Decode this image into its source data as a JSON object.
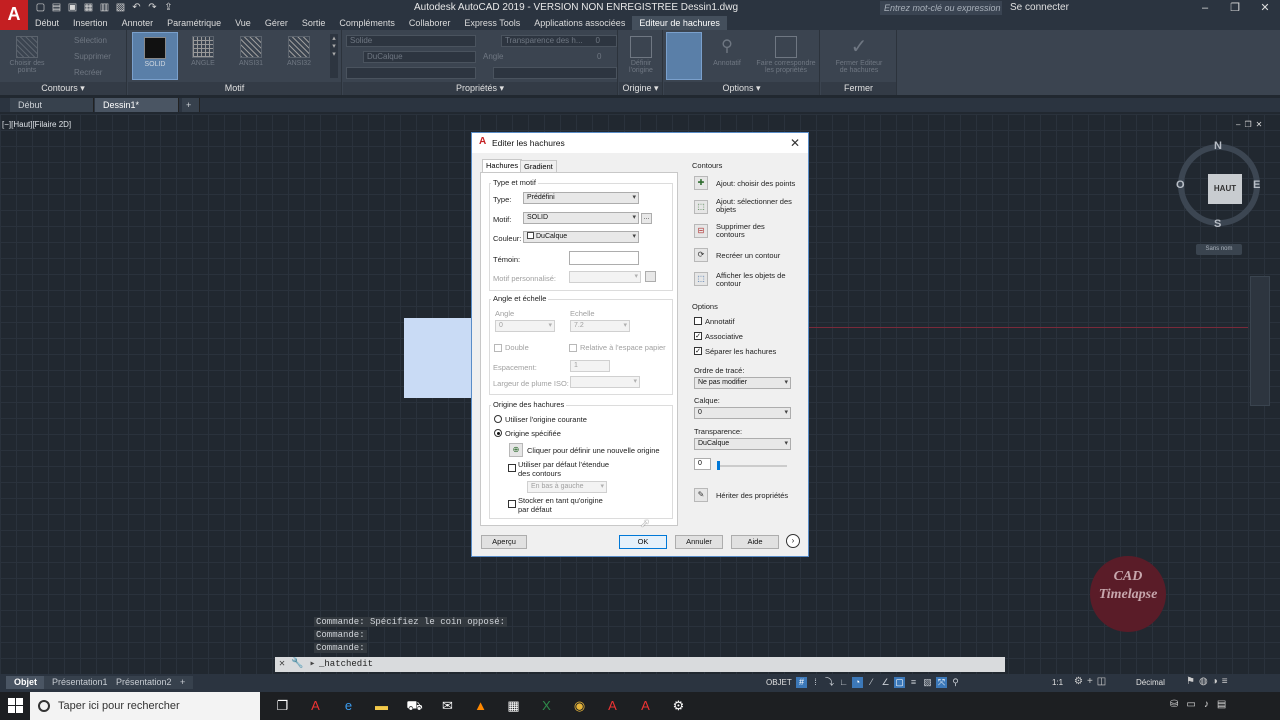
{
  "titlebar": {
    "logo": "A",
    "title": "Autodesk AutoCAD 2019 - VERSION NON ENREGISTREE    Dessin1.dwg",
    "search_placeholder": "Entrez mot-clé ou expression",
    "connect": "Se connecter",
    "qat_icons": [
      "new-icon",
      "open-icon",
      "save-icon",
      "saveas-icon",
      "print-icon",
      "plot-icon",
      "undo-icon",
      "redo-icon",
      "share-icon"
    ]
  },
  "menu": [
    "Début",
    "Insertion",
    "Annoter",
    "Paramétrique",
    "Vue",
    "Gérer",
    "Sortie",
    "Compléments",
    "Collaborer",
    "Express Tools",
    "Applications associées",
    "Editeur de hachures"
  ],
  "ribbon": {
    "contours": {
      "title": "Contours",
      "pick": "Choisir des points",
      "select": "Sélection",
      "remove": "Supprimer",
      "recreate": "Recréer"
    },
    "motif": {
      "title": "Motif",
      "patterns": [
        "SOLID",
        "ANGLE",
        "ANSI31",
        "ANSI32"
      ]
    },
    "proprietes": {
      "title": "Propriétés",
      "type": "Solide",
      "color": "DuCalque",
      "transparency": "Transparence des h...",
      "transparency_val": "0",
      "angle": "Angle",
      "angle_val": "0"
    },
    "origine": {
      "title": "Origine",
      "btn": "Définir l'origine"
    },
    "options": {
      "title": "Options",
      "assoc": "Associative",
      "annot": "Annotatif",
      "match": "Faire correspondre les propriétés"
    },
    "fermer": {
      "title": "Fermer",
      "btn": "Fermer Editeur de hachures"
    }
  },
  "doctabs": [
    "Début",
    "Dessin1*",
    "+"
  ],
  "viewport_label": "[−][Haut][Filaire 2D]",
  "viewcube": {
    "face": "HAUT",
    "n": "N",
    "s": "S",
    "e": "E",
    "o": "O",
    "ucs": "Sans nom"
  },
  "watermark": "CAD Timelapse",
  "command_history": [
    "Commande: Spécifiez le coin opposé:",
    "Commande:",
    "Commande:"
  ],
  "command_input": "_hatchedit",
  "layout_tabs": [
    "Objet",
    "Présentation1",
    "Présentation2",
    "+"
  ],
  "status": {
    "model": "OBJET",
    "units": "Décimal",
    "scale": "1:1"
  },
  "taskbar": {
    "search": "Taper ici pour rechercher"
  },
  "dialog": {
    "title": "Editer les hachures",
    "tabs": [
      "Hachures",
      "Gradient"
    ],
    "type_motif": {
      "group": "Type et motif",
      "type_label": "Type:",
      "type_value": "Prédéfini",
      "motif_label": "Motif:",
      "motif_value": "SOLID",
      "couleur_label": "Couleur:",
      "couleur_value": "DuCalque",
      "temoin_label": "Témoin:",
      "perso_label": "Motif personnalisé:"
    },
    "angle_echelle": {
      "group": "Angle et échelle",
      "angle_label": "Angle",
      "angle_value": "0",
      "echelle_label": "Echelle",
      "echelle_value": "7.2",
      "double": "Double",
      "relative": "Relative à l'espace papier",
      "espacement_label": "Espacement:",
      "espacement_value": "1",
      "plume_label": "Largeur de plume ISO:"
    },
    "origine": {
      "group": "Origine des hachures",
      "courante": "Utiliser l'origine courante",
      "specifiee": "Origine spécifiée",
      "cliquer": "Cliquer pour définir une nouvelle origine",
      "defaut_etendue": "Utiliser par défaut l'étendue des contours",
      "position": "En bas à gauche",
      "stocker": "Stocker en tant qu'origine par défaut"
    },
    "contours": {
      "group": "Contours",
      "ajout_points": "Ajout: choisir des points",
      "ajout_objets": "Ajout: sélectionner des objets",
      "supprimer": "Supprimer des contours",
      "recreer": "Recréer un contour",
      "afficher": "Afficher les objets de contour"
    },
    "options": {
      "group": "Options",
      "annotatif": "Annotatif",
      "associative": "Associative",
      "separer": "Séparer les hachures",
      "ordre_label": "Ordre de tracé:",
      "ordre_value": "Ne pas modifier",
      "calque_label": "Calque:",
      "calque_value": "0",
      "transparence_label": "Transparence:",
      "transparence_value": "DuCalque",
      "transparence_num": "0",
      "heriter": "Hériter des propriétés"
    },
    "buttons": {
      "apercu": "Aperçu",
      "ok": "OK",
      "annuler": "Annuler",
      "aide": "Aide"
    },
    "checks": {
      "annotatif": false,
      "associative": true,
      "separer": true,
      "double": false,
      "relative": false,
      "defaut_etendue": false,
      "stocker": false
    },
    "origin_mode": "specifiee"
  }
}
